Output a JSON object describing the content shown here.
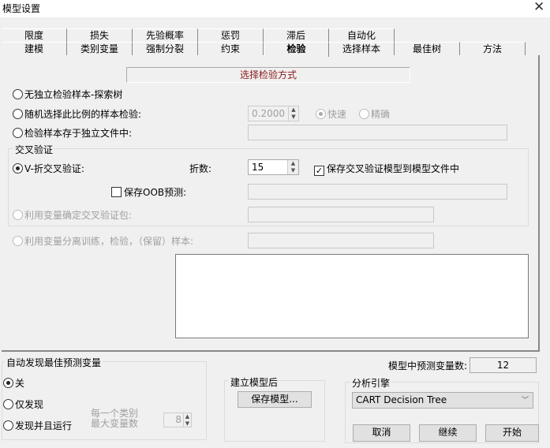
{
  "window": {
    "title": "模型设置",
    "close": "✕"
  },
  "tabs_row1": [
    "限度",
    "损失",
    "先验概率",
    "惩罚",
    "滞后",
    "自动化"
  ],
  "tabs_row2": [
    "建模",
    "类别变量",
    "强制分裂",
    "约束",
    "检验",
    "选择样本",
    "最佳树",
    "方法"
  ],
  "active_tab": "检验",
  "header": "选择检验方式",
  "options": {
    "no_test": "无独立检验样本-探索树",
    "random": "随机选择此比例的样本检验:",
    "random_value": "0.2000",
    "fast": "快速",
    "exact": "精确",
    "separate_file": "检验样本存于独立文件中:"
  },
  "cv": {
    "group_label": "交叉验证",
    "vfold": "V-折交叉验证:",
    "folds_label": "折数:",
    "folds_value": "15",
    "save_cv": "保存交叉验证模型到模型文件中",
    "save_oob": "保存OOB预测:",
    "var_bins": "利用变量确定交叉验证包:"
  },
  "var_separate": "利用变量分离训练，检验，（保留）样本:",
  "auto": {
    "group_label": "自动发现最佳预测变量",
    "off": "关",
    "discover_only": "仅发现",
    "discover_run": "发现并且运行",
    "per_class_l1": "每一个类别",
    "per_class_l2": "最大变量数",
    "per_class_value": "8"
  },
  "predictor_count_label": "模型中预测变量数:",
  "predictor_count": "12",
  "after_build": {
    "group_label": "建立模型后",
    "save_button": "保存模型..."
  },
  "engine": {
    "group_label": "分析引擎",
    "selected": "CART Decision Tree"
  },
  "buttons": {
    "cancel": "取消",
    "continue": "继续",
    "start": "开始"
  }
}
